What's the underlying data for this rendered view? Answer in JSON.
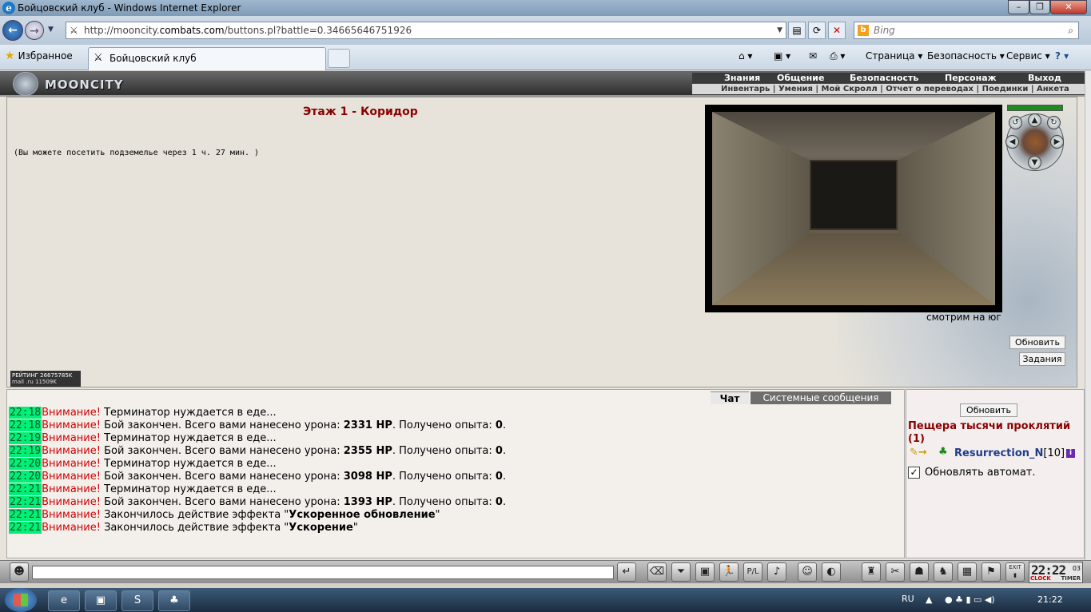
{
  "browser": {
    "window_title": "Бойцовский клуб - Windows Internet Explorer",
    "address_prefix": "http://mooncity.",
    "address_domain": "combats.com",
    "address_suffix": "/buttons.pl?battle=0.34665646751926",
    "search_placeholder": "Bing",
    "favorites_label": "Избранное",
    "tab_title": "Бойцовский клуб",
    "commands": {
      "page": "Страница",
      "security": "Безопасность",
      "service": "Сервис"
    }
  },
  "game": {
    "logo_text": "MOONCITY",
    "top_menu": [
      "Знания",
      "Общение",
      "Безопасность",
      "Персонаж",
      "Выход"
    ],
    "sub_menu": "Инвентарь | Умения | Мой Скролл | Отчет о переводах | Поединки | Анкета",
    "floor_title": "Этаж 1 - Коридор",
    "visit_note": "(Вы можете посетить подземелье через 1 ч. 27 мин. )",
    "facing": "смотрим на юг",
    "refresh_button": "Обновить",
    "tasks_button": "Задания",
    "rating_label": "РЕЙТИНГ 26675785K",
    "rating_sub": "mail .ru 11509K",
    "hp_fill": 1.0
  },
  "chat": {
    "tab_chat": "Чат",
    "tab_system": "Системные сообщения",
    "lines": [
      {
        "time": "22:18",
        "warn": "Внимание!",
        "pre": " Терминатор нуждается в еде...",
        "bold1": "",
        "mid": "",
        "bold2": "",
        "post": ""
      },
      {
        "time": "22:18",
        "warn": "Внимание!",
        "pre": " Бой закончен. Всего вами нанесено урона: ",
        "bold1": "2331 HP",
        "mid": ". Получено опыта: ",
        "bold2": "0",
        "post": "."
      },
      {
        "time": "22:19",
        "warn": "Внимание!",
        "pre": " Терминатор нуждается в еде...",
        "bold1": "",
        "mid": "",
        "bold2": "",
        "post": ""
      },
      {
        "time": "22:19",
        "warn": "Внимание!",
        "pre": " Бой закончен. Всего вами нанесено урона: ",
        "bold1": "2355 HP",
        "mid": ". Получено опыта: ",
        "bold2": "0",
        "post": "."
      },
      {
        "time": "22:20",
        "warn": "Внимание!",
        "pre": " Терминатор нуждается в еде...",
        "bold1": "",
        "mid": "",
        "bold2": "",
        "post": ""
      },
      {
        "time": "22:20",
        "warn": "Внимание!",
        "pre": " Бой закончен. Всего вами нанесено урона: ",
        "bold1": "3098 HP",
        "mid": ". Получено опыта: ",
        "bold2": "0",
        "post": "."
      },
      {
        "time": "22:21",
        "warn": "Внимание!",
        "pre": " Терминатор нуждается в еде...",
        "bold1": "",
        "mid": "",
        "bold2": "",
        "post": ""
      },
      {
        "time": "22:21",
        "warn": "Внимание!",
        "pre": " Бой закончен. Всего вами нанесено урона: ",
        "bold1": "1393 HP",
        "mid": ". Получено опыта: ",
        "bold2": "0",
        "post": "."
      },
      {
        "time": "22:21",
        "warn": "Внимание!",
        "pre": " Закончилось действие эффекта \"",
        "bold1": "Ускоренное обновление",
        "mid": "\"",
        "bold2": "",
        "post": ""
      },
      {
        "time": "22:21",
        "warn": "Внимание!",
        "pre": " Закончилось действие эффекта \"",
        "bold1": "Ускорение",
        "mid": "\"",
        "bold2": "",
        "post": ""
      }
    ]
  },
  "room": {
    "refresh_button": "Обновить",
    "location": "Пещера тысячи проклятий (1)",
    "user_name": "Resurrection_N",
    "user_level": "[10]",
    "auto_refresh_label": "Обновлять автомат.",
    "auto_refresh_checked": true
  },
  "clock": {
    "time": "22:22",
    "seconds": "03",
    "label_clock": "CLOCK",
    "label_timer": "TIMER",
    "exit_label": "EXIT"
  },
  "taskbar": {
    "lang": "RU",
    "time": "21:22"
  }
}
